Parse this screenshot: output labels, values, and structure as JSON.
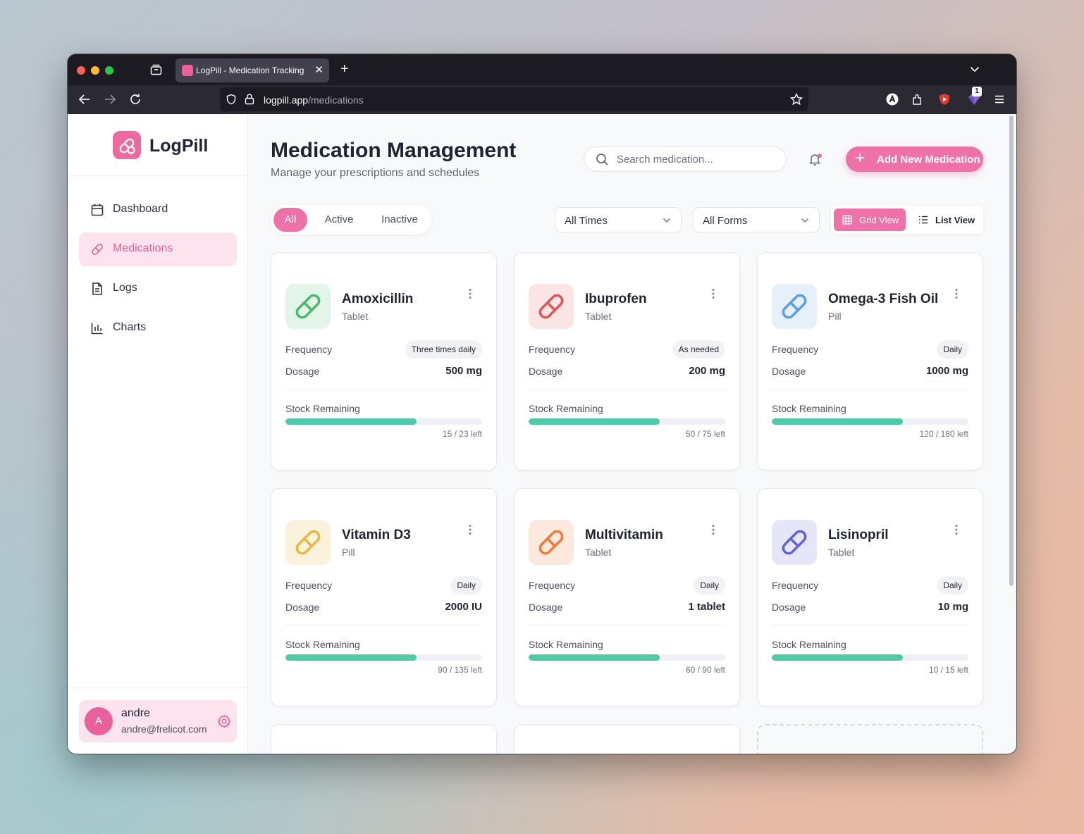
{
  "browser": {
    "tab_title": "LogPill - Medication Tracking",
    "tab_close": "✕",
    "new_tab": "+",
    "url_domain": "logpill.app",
    "url_path": "/medications",
    "extension_badge": "1"
  },
  "sidebar": {
    "brand": "LogPill",
    "items": [
      {
        "label": "Dashboard",
        "icon": "calendar-icon",
        "active": false
      },
      {
        "label": "Medications",
        "icon": "pill-icon",
        "active": true
      },
      {
        "label": "Logs",
        "icon": "document-icon",
        "active": false
      },
      {
        "label": "Charts",
        "icon": "bar-chart-icon",
        "active": false
      }
    ],
    "user": {
      "initial": "A",
      "name": "andre",
      "email": "andre@frelicot.com"
    }
  },
  "header": {
    "title": "Medication Management",
    "subtitle": "Manage your prescriptions and schedules",
    "search_placeholder": "Search medication...",
    "add_button": "Add New Medication"
  },
  "filters": {
    "status_tabs": [
      "All",
      "Active",
      "Inactive"
    ],
    "status_selected": "All",
    "time_select": "All Times",
    "form_select": "All Forms",
    "views": [
      "Grid View",
      "List View"
    ],
    "view_selected": "Grid View"
  },
  "colors": {
    "accent": "#ee72a7",
    "stock_bar": "#4ecaa8"
  },
  "medications": [
    {
      "name": "Amoxicillin",
      "form": "Tablet",
      "frequency_label": "Frequency",
      "frequency": "Three times daily",
      "dosage_label": "Dosage",
      "dosage": "500 mg",
      "stock_label": "Stock Remaining",
      "stock_text": "15 / 23 left",
      "stock_fraction": 0.665,
      "icon_color": "#4bb86a",
      "icon_bg": "#e3f5e8"
    },
    {
      "name": "Ibuprofen",
      "form": "Tablet",
      "frequency_label": "Frequency",
      "frequency": "As needed",
      "dosage_label": "Dosage",
      "dosage": "200 mg",
      "stock_label": "Stock Remaining",
      "stock_text": "50 / 75 left",
      "stock_fraction": 0.665,
      "icon_color": "#e05555",
      "icon_bg": "#fbe4e4"
    },
    {
      "name": "Omega-3 Fish Oil",
      "form": "Pill",
      "frequency_label": "Frequency",
      "frequency": "Daily",
      "dosage_label": "Dosage",
      "dosage": "1000 mg",
      "stock_label": "Stock Remaining",
      "stock_text": "120 / 180 left",
      "stock_fraction": 0.665,
      "icon_color": "#5a9de6",
      "icon_bg": "#e6f0fb"
    },
    {
      "name": "Vitamin D3",
      "form": "Pill",
      "frequency_label": "Frequency",
      "frequency": "Daily",
      "dosage_label": "Dosage",
      "dosage": "2000 IU",
      "stock_label": "Stock Remaining",
      "stock_text": "90 / 135 left",
      "stock_fraction": 0.665,
      "icon_color": "#e6b640",
      "icon_bg": "#fbf2dc"
    },
    {
      "name": "Multivitamin",
      "form": "Tablet",
      "frequency_label": "Frequency",
      "frequency": "Daily",
      "dosage_label": "Dosage",
      "dosage": "1 tablet",
      "stock_label": "Stock Remaining",
      "stock_text": "60 / 90 left",
      "stock_fraction": 0.665,
      "icon_color": "#ea7b3c",
      "icon_bg": "#fce8dc"
    },
    {
      "name": "Lisinopril",
      "form": "Tablet",
      "frequency_label": "Frequency",
      "frequency": "Daily",
      "dosage_label": "Dosage",
      "dosage": "10 mg",
      "stock_label": "Stock Remaining",
      "stock_text": "10 / 15 left",
      "stock_fraction": 0.665,
      "icon_color": "#5c63d6",
      "icon_bg": "#e5e6f9"
    }
  ]
}
